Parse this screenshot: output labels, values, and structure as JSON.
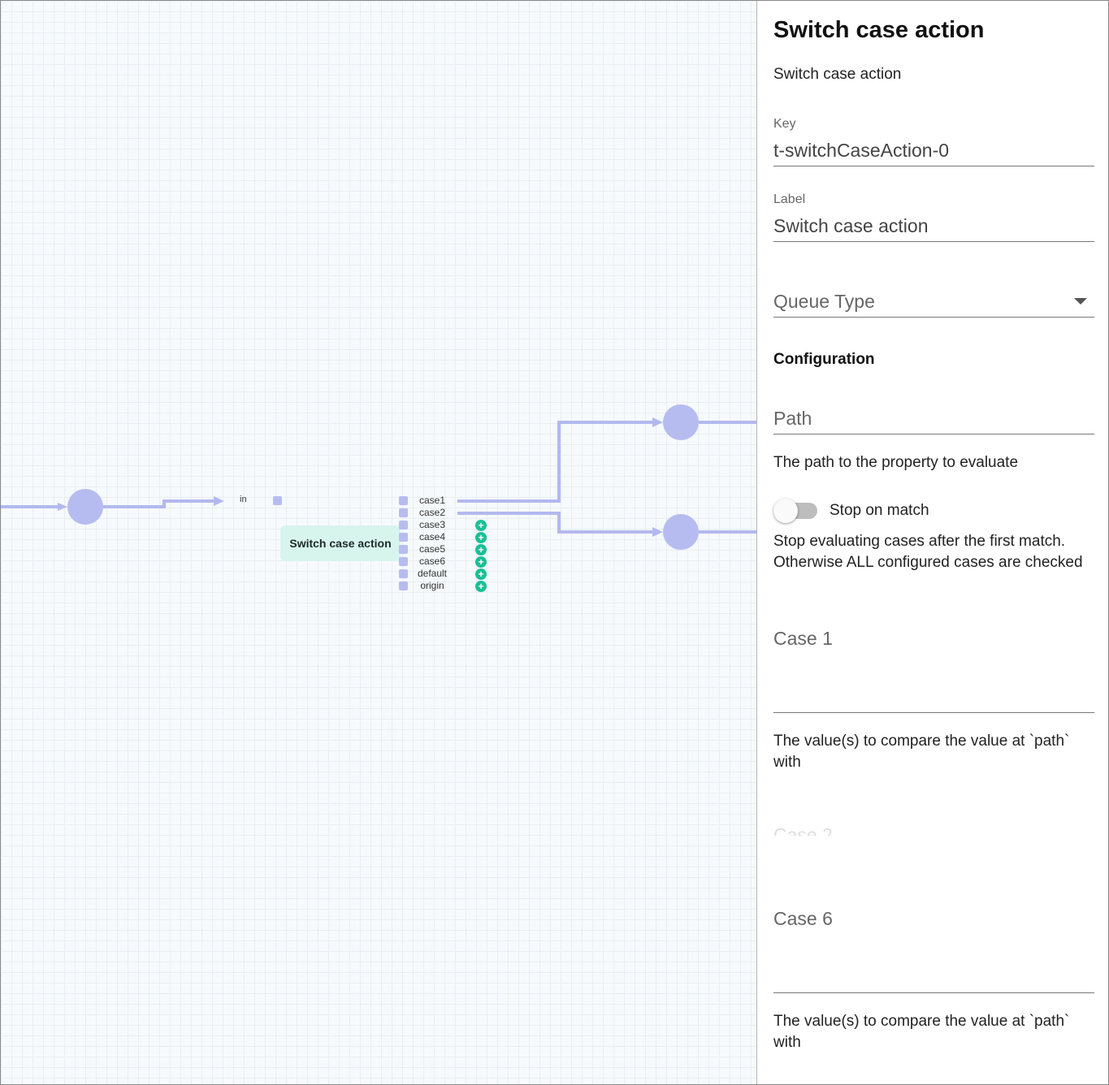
{
  "canvas": {
    "node_title": "Switch case action",
    "input_port_label": "in",
    "output_ports": [
      "case1",
      "case2",
      "case3",
      "case4",
      "case5",
      "case6",
      "default",
      "origin"
    ],
    "plus_glyph": "+",
    "colors": {
      "edge": "#b3b9ee",
      "node_circle": "#b7bcf0",
      "node_card": "#d7f5ed",
      "add_port": "#1bbf96"
    }
  },
  "panel": {
    "title": "Switch case action",
    "subtitle": "Switch case action",
    "key": {
      "label": "Key",
      "value": "t-switchCaseAction-0"
    },
    "label_field": {
      "label": "Label",
      "value": "Switch case action"
    },
    "queue_type": {
      "placeholder": "Queue Type",
      "icon": "arrow-drop-down-icon"
    },
    "configuration_heading": "Configuration",
    "path": {
      "placeholder": "Path",
      "helper": "The path to the property to evaluate"
    },
    "stop_on_match": {
      "label": "Stop on match",
      "enabled": false,
      "helper": "Stop evaluating cases after the first match. Otherwise ALL configured cases are checked"
    },
    "case1": {
      "placeholder": "Case 1",
      "helper": "The value(s) to compare the value at `path` with"
    },
    "case2_faded": "Case 2",
    "case6": {
      "placeholder": "Case 6",
      "helper": "The value(s) to compare the value at `path` with"
    }
  }
}
